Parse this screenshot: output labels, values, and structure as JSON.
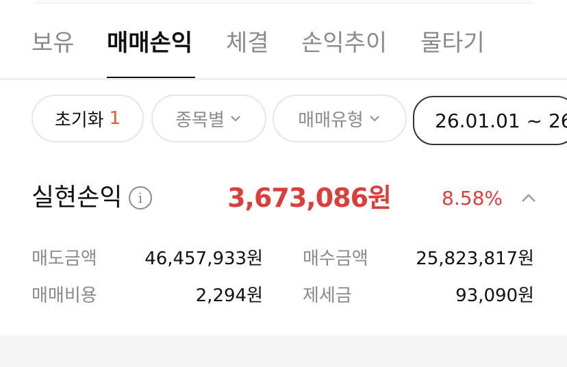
{
  "tabs": [
    {
      "label": "보유",
      "active": false
    },
    {
      "label": "매매손익",
      "active": true
    },
    {
      "label": "체결",
      "active": false
    },
    {
      "label": "손익추이",
      "active": false
    },
    {
      "label": "물타기",
      "active": false
    }
  ],
  "filters": {
    "reset_label": "초기화",
    "reset_count": "1",
    "by_stock_label": "종목별",
    "trade_type_label": "매매유형",
    "date_range": "26.01.01 ~ 26"
  },
  "summary": {
    "label": "실현손익",
    "info_icon": "i",
    "amount": "3,673,086원",
    "rate": "8.58%"
  },
  "details": {
    "sell_amount_label": "매도금액",
    "sell_amount_value": "46,457,933원",
    "buy_amount_label": "매수금액",
    "buy_amount_value": "25,823,817원",
    "trade_cost_label": "매매비용",
    "trade_cost_value": "2,294원",
    "tax_label": "제세금",
    "tax_value": "93,090원"
  },
  "colors": {
    "profit": "#d8403b",
    "count_accent": "#e05a2b",
    "muted": "#8a8a8a"
  }
}
